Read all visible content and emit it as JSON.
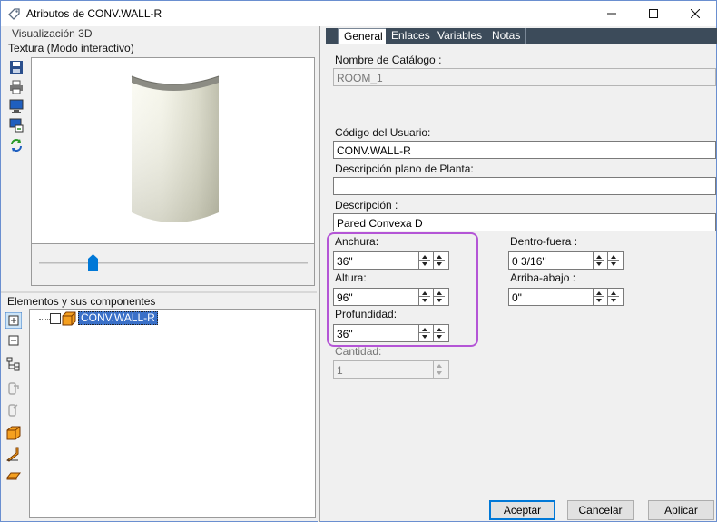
{
  "window": {
    "title": "Atributos de CONV.WALL-R",
    "minimize_glyph": "—",
    "maximize_glyph": "☐",
    "close_glyph": "✕"
  },
  "left_panel": {
    "viz_label": "Visualización 3D",
    "texture_label": "Textura (Modo interactivo)",
    "toolbar_icons": [
      "save-icon",
      "print-icon",
      "monitor-icon",
      "export-view-icon",
      "refresh-icon"
    ],
    "slider_value": 0.2
  },
  "tree_panel": {
    "label": "Elementos y sus componentes",
    "toolbar_icons": [
      "expand-icon",
      "collapse-icon",
      "hierarchy-icon",
      "paste-icon",
      "copy-icon",
      "box-icon",
      "wall-icon",
      "slab-icon"
    ],
    "item_label": "CONV.WALL-R"
  },
  "tabs": [
    "General",
    "Enlaces",
    "Variables",
    "Notas"
  ],
  "form": {
    "catalog_label": "Nombre de Catálogo :",
    "catalog_value": "ROOM_1",
    "user_code_label": "Código del Usuario:",
    "user_code_value": "CONV.WALL-R",
    "floorplan_desc_label": "Descripción plano de Planta:",
    "floorplan_desc_value": "",
    "desc_label": "Descripción :",
    "desc_value": "Pared Convexa D",
    "width_label": "Anchura:",
    "width_value": "36\"",
    "height_label": "Altura:",
    "height_value": "96\"",
    "depth_label": "Profundidad:",
    "depth_value": "36\"",
    "quantity_label": "Cantidad:",
    "quantity_value": "1",
    "inout_label": "Dentro-fuera :",
    "inout_value": "0 3/16\"",
    "updown_label": "Arriba-abajo :",
    "updown_value": "0\""
  },
  "buttons": {
    "accept": "Aceptar",
    "cancel": "Cancelar",
    "apply": "Aplicar"
  },
  "colors": {
    "tab_bar": "#3c4b5a",
    "highlight": "#b455d6",
    "selection": "#3a70c8",
    "default_button": "#0078d7"
  }
}
